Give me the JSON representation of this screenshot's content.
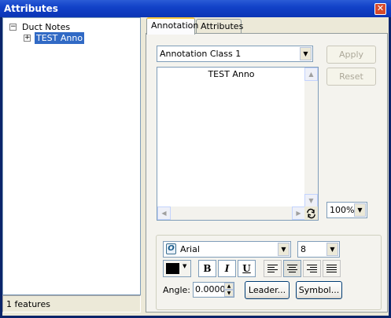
{
  "window": {
    "title": "Attributes",
    "close_glyph": "✕"
  },
  "tree": {
    "root": {
      "label": "Duct Notes",
      "expander": "−"
    },
    "child": {
      "label": "TEST Anno",
      "expander": "+"
    }
  },
  "status": {
    "text": "1 features"
  },
  "tabs": [
    {
      "label": "Annotation"
    },
    {
      "label": "Attributes"
    }
  ],
  "annotation": {
    "class_value": "Annotation Class 1",
    "text": "TEST Anno",
    "apply_label": "Apply",
    "reset_label": "Reset",
    "zoom_value": "100%",
    "font_name": "Arial",
    "font_size": "8",
    "bold_label": "B",
    "italic_label": "I",
    "underline_label": "U",
    "angle_label": "Angle:",
    "angle_value": "0.0000",
    "leader_label": "Leader...",
    "symbol_label": "Symbol...",
    "color": "#000000",
    "alignment": "center"
  },
  "colors": {
    "titlebar": "#0b35b5",
    "selection": "#316ac5",
    "tab_highlight": "#ffc83c",
    "close": "#d64a2c"
  },
  "icons": [
    "close-icon",
    "refresh-icon",
    "font-icon",
    "chevron-down-icon",
    "align-left-icon",
    "align-center-icon",
    "align-right-icon",
    "align-justify-icon"
  ]
}
